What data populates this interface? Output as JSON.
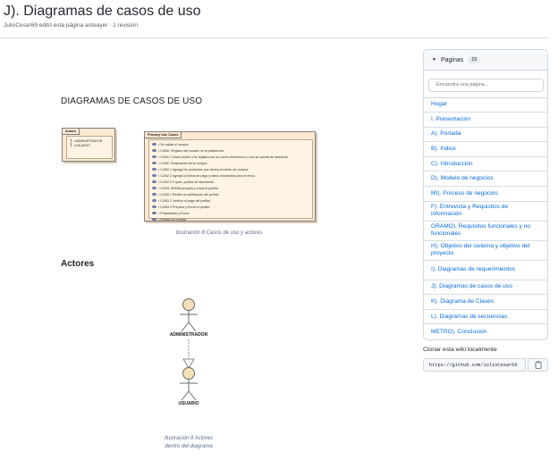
{
  "page": {
    "title": "J). Diagramas de casos de uso",
    "meta": "JulioCesar69 editó esta página anteayer · 1 revisión"
  },
  "content": {
    "doc_heading": "DIAGRAMAS DE CASOS DE USO",
    "actors_section_heading": "Actores",
    "diagram1": {
      "actors_box_title": "Actors",
      "actors": [
        "•ADMINISTRADOR",
        "•USUARIO"
      ],
      "usecases_box_title": "Primary Use Cases",
      "usecases": [
        "• Se valida el usuario",
        "• CUN0. Registro del usuario en la plataforma",
        "• CUN1.1 Inicia sesión o se registra con su correo electrónico o con su cuenta de facebook",
        "• CUN2. Realización de la compra",
        "• CUN2.1 Agrega los productos que desea al carrito de compra",
        "• CUN2.2 Agrega la forma de pago y datos necesarios para el envío",
        "• CUN2.3 Cupón, puntos de descuento",
        "• CUN3. ADMIN prepara y envía el pedido",
        "• CUN3.1 Recibe la notificación del pedido",
        "• CUN3.2 Verifica el pago del pedido",
        "• CUN3.3 Prepara y Envía el pedido",
        "• Preparación y Envío",
        "• Realiza la compra"
      ],
      "caption": "Ilustración 8 Casos de uso y actores"
    },
    "diagram2": {
      "actor1_label": "ADMINISTRADOR",
      "actor2_label": "USUARIO",
      "caption_line1": "Ilustración 9 Actores",
      "caption_line2": "dentro del diagrama"
    }
  },
  "sidebar": {
    "header_label": "Paginas",
    "count": "15",
    "search_placeholder": "Encuentra una página...",
    "items": [
      {
        "label": "Hogar"
      },
      {
        "label": "I. Presentación"
      },
      {
        "label": "A). Portada"
      },
      {
        "label": "B). Indice"
      },
      {
        "label": "C). Introducción"
      },
      {
        "label": "D). Modelo de negocios"
      },
      {
        "label": "MI). Proceso de negocios"
      },
      {
        "label": "F) .Entrevista y Requisitos de información"
      },
      {
        "label": "GRAMO). Requisitos funcionales y no funcionales"
      },
      {
        "label": "H). Objetivo del sistema y objetivo del proyecto"
      },
      {
        "label": "I). Diagramas de requerimientos"
      },
      {
        "label": "J). Diagramas de casos de uso"
      },
      {
        "label": "K). Diagrama de Clases"
      },
      {
        "label": "L). Diagramas de secuencias"
      },
      {
        "label": "METRO). Conclusión"
      }
    ]
  },
  "clone": {
    "label": "Clonar esta wiki localmente",
    "url": "https://github.com/JulioCesar69"
  },
  "colors": {
    "link": "#0969da",
    "uml_fill": "#fde8d0",
    "actor_fill": "#f5dfb8"
  },
  "icons": {
    "caret": "triangle-down-icon",
    "copy": "clipboard-copy-icon"
  }
}
